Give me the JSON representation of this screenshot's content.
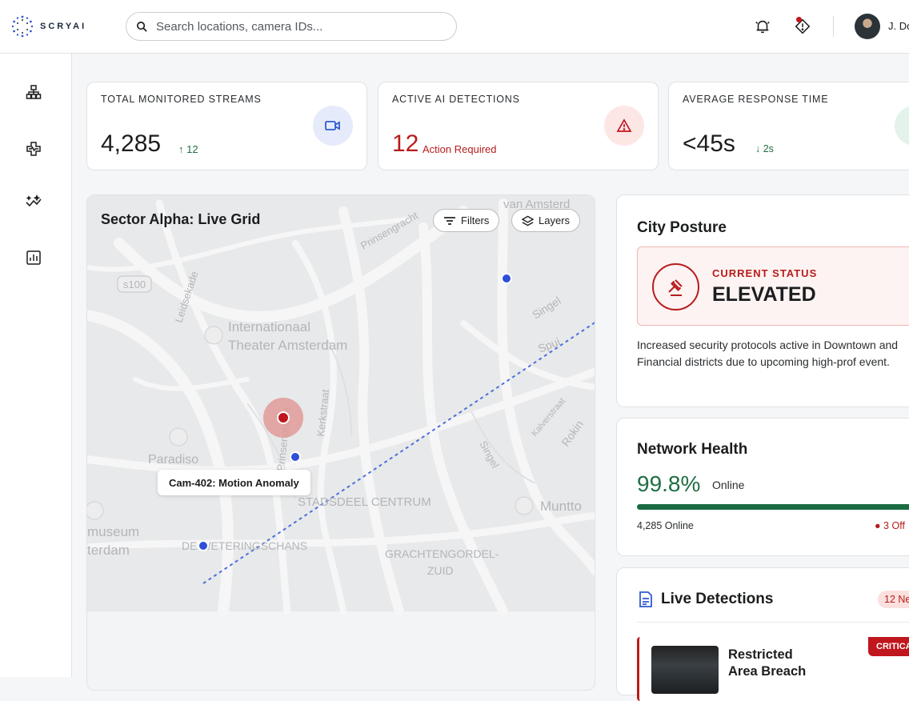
{
  "app": {
    "logo_text": "SCRYAI"
  },
  "search": {
    "placeholder": "Search locations, camera IDs..."
  },
  "user": {
    "name": "J. Do"
  },
  "stats": [
    {
      "label": "TOTAL MONITORED STREAMS",
      "value": "4,285",
      "delta": "12",
      "delta_direction": "up",
      "icon": "video-camera-icon",
      "accent": "#2f5bd3"
    },
    {
      "label": "ACTIVE AI DETECTIONS",
      "value": "12",
      "note": "Action Required",
      "icon": "warning-triangle-icon",
      "accent": "#c0161d"
    },
    {
      "label": "AVERAGE RESPONSE TIME",
      "value": "<45s",
      "delta": "2s",
      "delta_direction": "down",
      "icon": "clock-icon",
      "accent": "#1f6f43"
    }
  ],
  "map": {
    "title": "Sector Alpha: Live Grid",
    "filters_label": "Filters",
    "layers_label": "Layers",
    "tooltip": "Cam-402: Motion Anomaly",
    "labels": {
      "prinsengracht": "Prinsengracht",
      "van_amsterdam": "van Amsterd",
      "s100": "s100",
      "leidsekade": "Leidsekade",
      "theater_1": "Internationaal",
      "theater_2": "Theater Amsterdam",
      "singel_1": "Singel",
      "spui": "Spui",
      "kerkstraat": "Kerkstraat",
      "kalverstraat": "Kalverstraat",
      "rokin": "Rokin",
      "singel_2": "Singel",
      "paradiso": "Paradiso",
      "prinsengracht_2": "Prinsengracht",
      "stadsdeel": "STADSDEEL CENTRUM",
      "muntto": "Muntto",
      "museum": "museum",
      "terdam": "terdam",
      "weteringschans": "DE WETERINGSCHANS",
      "grachtengordel": "GRACHTENGORDEL-",
      "zuid": "ZUID"
    }
  },
  "posture": {
    "title": "City Posture",
    "status_label": "CURRENT STATUS",
    "status_value": "ELEVATED",
    "description": "Increased security protocols active in Downtown and Financial districts due to upcoming high-prof event.",
    "accent": "#b71c1c"
  },
  "health": {
    "title": "Network Health",
    "value": "99.8%",
    "value_suffix": "Online",
    "progress": 0.998,
    "online_text": "4,285 Online",
    "offline_text": "3 Off"
  },
  "detections": {
    "title": "Live Detections",
    "badge": "12 Ne",
    "items": [
      {
        "title": "Restricted Area Breach",
        "severity": "CRITICA"
      }
    ]
  }
}
